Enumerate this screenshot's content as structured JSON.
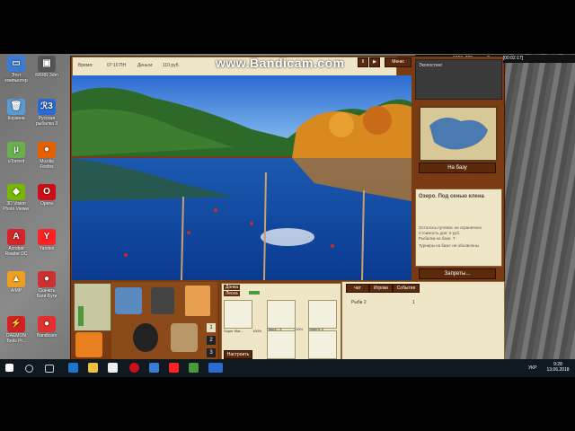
{
  "desktop_icons": [
    {
      "label": "Этот компьютер",
      "color": "#3a7bd5",
      "glyph": "▭"
    },
    {
      "label": "Корзина",
      "color": "#5a9ad5",
      "glyph": "🗑"
    },
    {
      "label": "uTorrent",
      "color": "#6ab04c",
      "glyph": "µ"
    },
    {
      "label": "3D Vision Photo Viewer",
      "color": "#76b900",
      "glyph": "◆"
    },
    {
      "label": "Acrobat Reader DC",
      "color": "#d4242a",
      "glyph": "A"
    },
    {
      "label": "AIMP",
      "color": "#f0a020",
      "glyph": "▲"
    },
    {
      "label": "DAEMON Tools Pr...",
      "color": "#d42020",
      "glyph": "⚡"
    },
    {
      "label": "RRRR 3dm",
      "color": "#555",
      "glyph": "▣"
    },
    {
      "label": "Русская рыбалка 3",
      "color": "#2a6ad5",
      "glyph": "ℛ3"
    },
    {
      "label": "Mozilla Firefox",
      "color": "#e66000",
      "glyph": "●"
    },
    {
      "label": "Opera",
      "color": "#cc0f16",
      "glyph": "O"
    },
    {
      "label": "Yandex",
      "color": "#ff2222",
      "glyph": "Y"
    },
    {
      "label": "Скачать Баги-Буги",
      "color": "#cc3030",
      "glyph": "●"
    },
    {
      "label": "Bandicam",
      "color": "#e03030",
      "glyph": "●"
    }
  ],
  "watermark": "www.Bandicam.com",
  "recorder": {
    "resolution": "1360x768",
    "status": "Запись [00:02:17]"
  },
  "game": {
    "time_label": "Время:",
    "time_value": "07:10 ПН",
    "money_label": "Деньги:",
    "money_value": "110 руб.",
    "menu_label": "Меню",
    "pause_label": "II",
    "ecology_label": "Экопостинг",
    "to_base_button": "На базу",
    "lake_title": "Озеро. Под сенью клена",
    "info_lines": [
      "Осталось путевок: не ограничено",
      "Стоимость дня: 0 руб.",
      "Рыбалка на базе: Т",
      "Турниры на базе: не объявлены"
    ],
    "restrictions_button": "Запреты...",
    "tackle_hint": "Донка",
    "tackle_sub": "Леска",
    "slot_labels": [
      "Super Mat...",
      "Ниша - 3",
      "Инвент-3",
      "",
      "8 кг",
      ""
    ],
    "percent_a": "100%",
    "percent_b": "100%",
    "setup_button": "Настроить",
    "counters": [
      "1",
      "2",
      "3"
    ],
    "chat_tabs": [
      "чат",
      "Игроки",
      "События"
    ],
    "chat_row": {
      "name": "Рыба 2",
      "value": "1"
    }
  },
  "taskbar": {
    "lang": "УКР",
    "time": "9:28",
    "date": "13.06.2018"
  },
  "colors": {
    "brand_brown": "#7a3a12",
    "panel_cream": "#efe6c8",
    "taskbar": "#101820"
  }
}
